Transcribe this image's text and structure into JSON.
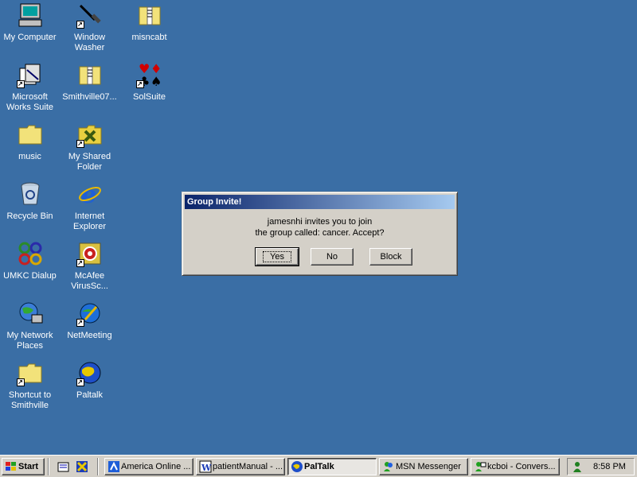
{
  "desktop": {
    "icons": [
      {
        "label": "My Computer",
        "icon": "my-computer-icon"
      },
      {
        "label": "Window Washer",
        "icon": "window-washer-icon"
      },
      {
        "label": "misncabt",
        "icon": "zip-folder-icon"
      },
      {
        "label": "Microsoft Works Suite",
        "icon": "works-suite-icon"
      },
      {
        "label": "Smithville07...",
        "icon": "zip-folder-icon"
      },
      {
        "label": "SolSuite",
        "icon": "card-suits-icon"
      },
      {
        "label": "music",
        "icon": "folder-icon"
      },
      {
        "label": "My Shared Folder",
        "icon": "shared-folder-icon"
      },
      {
        "label": "Recycle Bin",
        "icon": "recycle-bin-icon"
      },
      {
        "label": "Internet Explorer",
        "icon": "internet-explorer-icon"
      },
      {
        "label": "UMKC Dialup",
        "icon": "dialup-icon"
      },
      {
        "label": "McAfee VirusSc...",
        "icon": "mcafee-icon"
      },
      {
        "label": "My Network Places",
        "icon": "network-places-icon"
      },
      {
        "label": "NetMeeting",
        "icon": "netmeeting-icon"
      },
      {
        "label": "Shortcut to Smithville",
        "icon": "folder-shortcut-icon"
      },
      {
        "label": "Paltalk",
        "icon": "paltalk-icon"
      }
    ]
  },
  "dialog": {
    "title": "Group Invite!",
    "line1": "jamesnhi invites you to join",
    "line2": "the group called:  cancer.  Accept?",
    "yes_label": "Yes",
    "no_label": "No",
    "block_label": "Block"
  },
  "taskbar": {
    "start_label": "Start",
    "quick_launch": [
      "desktop-icon",
      "paltalk-quick-icon"
    ],
    "tasks": [
      {
        "label": "America  Online ...",
        "icon": "aol-icon",
        "active": false
      },
      {
        "label": "patientManual - ...",
        "icon": "word-icon",
        "active": false
      },
      {
        "label": "PalTalk",
        "icon": "paltalk-icon",
        "active": true
      },
      {
        "label": "MSN Messenger",
        "icon": "msn-icon",
        "active": false
      },
      {
        "label": "kcboi - Convers...",
        "icon": "msn-chat-icon",
        "active": false
      }
    ],
    "clock": "8:58 PM"
  },
  "colors": {
    "desktop": "#3A6EA5",
    "titlebar_start": "#0A246A",
    "titlebar_end": "#A6CAF0",
    "face": "#D4D0C8"
  }
}
